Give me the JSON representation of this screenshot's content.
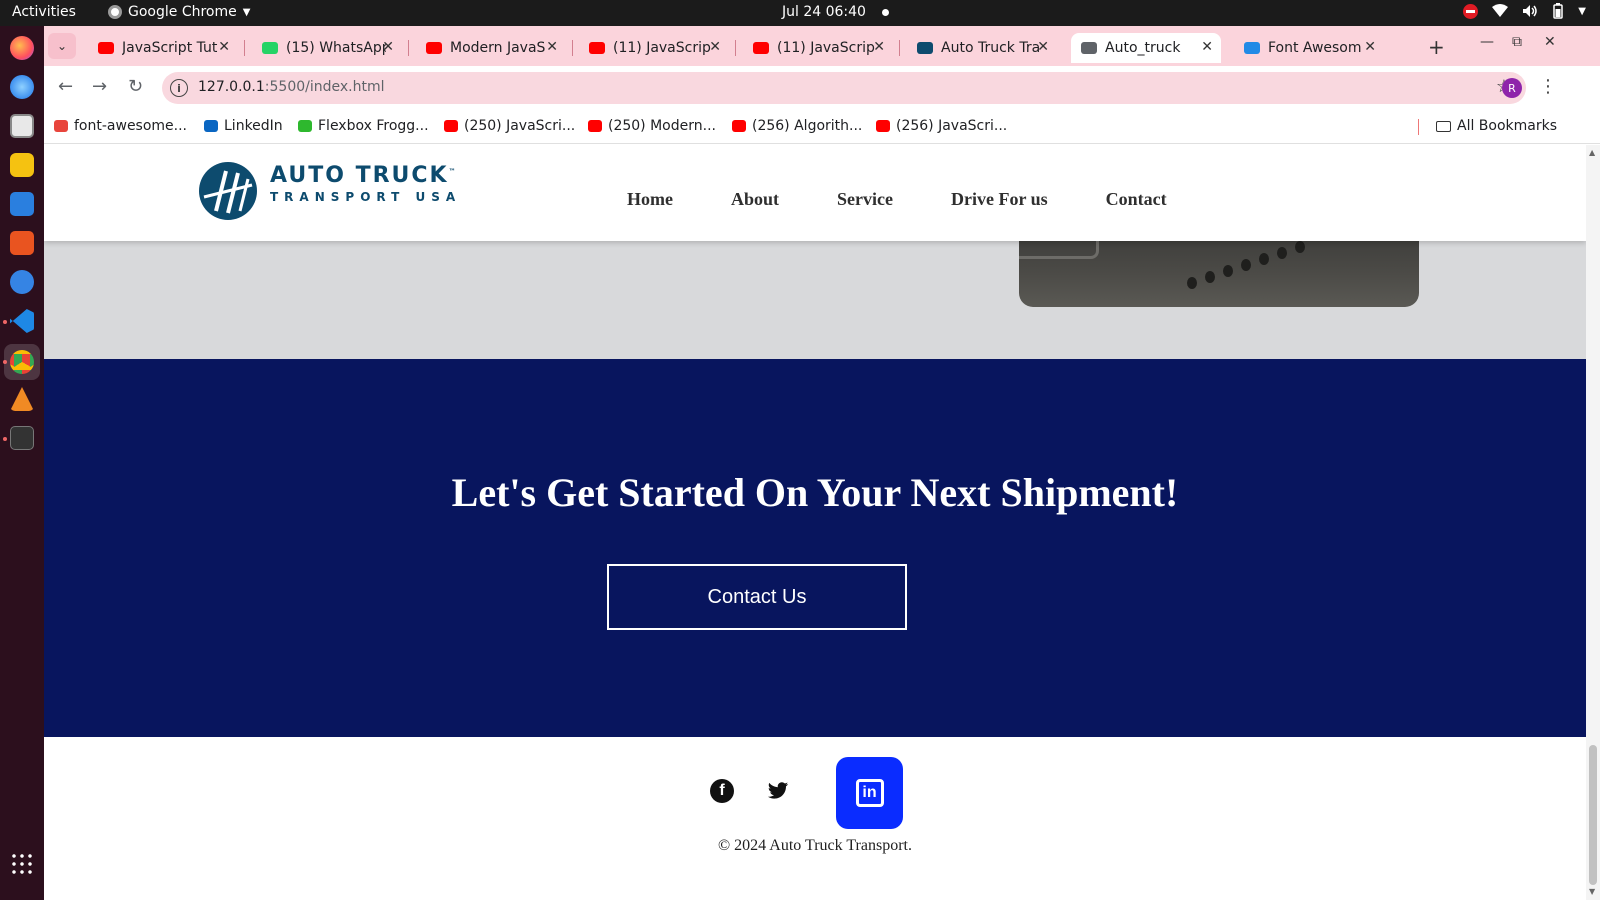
{
  "os": {
    "activities": "Activities",
    "app_name": "Google Chrome",
    "clock": "Jul 24  06:40"
  },
  "browser": {
    "tabs": [
      {
        "title": "JavaScript Tut",
        "favicon": "youtube-icon",
        "color": "#ff0000"
      },
      {
        "title": "(15) WhatsApp",
        "favicon": "whatsapp-icon",
        "color": "#25d366"
      },
      {
        "title": "Modern JavaS",
        "favicon": "youtube-icon",
        "color": "#ff0000"
      },
      {
        "title": "(11) JavaScrip",
        "favicon": "youtube-icon",
        "color": "#ff0000"
      },
      {
        "title": "(11) JavaScrip",
        "favicon": "youtube-icon",
        "color": "#ff0000"
      },
      {
        "title": "Auto Truck Tra",
        "favicon": "auto-truck-logo-icon",
        "color": "#0d4b6e"
      },
      {
        "title": "Auto_truck",
        "favicon": "globe-icon",
        "color": "#5f6368",
        "active": true
      },
      {
        "title": "Font Awesom",
        "favicon": "flag-icon",
        "color": "#228ae6"
      }
    ],
    "url_host": "127.0.0.1",
    "url_rest": ":5500/index.html",
    "profile_initial": "R",
    "bookmarks": [
      {
        "label": "font-awesome...",
        "icon": "code-icon",
        "color": "#e8453c"
      },
      {
        "label": "LinkedIn",
        "icon": "linkedin-icon",
        "color": "#0a66c2"
      },
      {
        "label": "Flexbox Frogg...",
        "icon": "frog-icon",
        "color": "#2eb82e"
      },
      {
        "label": "(250) JavaScri...",
        "icon": "youtube-icon",
        "color": "#ff0000"
      },
      {
        "label": "(250) Modern...",
        "icon": "youtube-icon",
        "color": "#ff0000"
      },
      {
        "label": "(256) Algorith...",
        "icon": "youtube-icon",
        "color": "#ff0000"
      },
      {
        "label": "(256) JavaScri...",
        "icon": "youtube-icon",
        "color": "#ff0000"
      }
    ],
    "all_bookmarks": "All Bookmarks"
  },
  "site": {
    "logo_line1": "AUTO TRUCK",
    "logo_tm": "™",
    "logo_line2": "TRANSPORT USA",
    "nav": [
      "Home",
      "About",
      "Service",
      "Drive For us",
      "Contact"
    ],
    "cta_heading": "Let's Get Started On Your Next Shipment!",
    "cta_button": "Contact Us",
    "copyright": "© 2024 Auto Truck Transport.",
    "colors": {
      "cta_bg": "#08155e",
      "gray_band": "#d8d9db",
      "linkedin_bg": "#0a2cff",
      "logo_blue": "#0d4b6e"
    }
  }
}
